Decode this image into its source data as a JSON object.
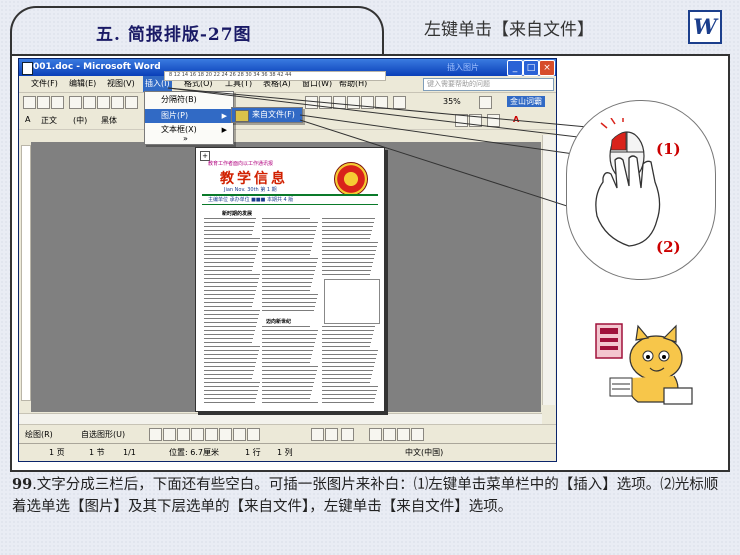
{
  "slide": {
    "section_title": "五. 简报排版-27图",
    "hint": "左键单击【来自文件】",
    "logo_letter": "W"
  },
  "window": {
    "title": "001.doc - Microsoft Word",
    "title_ghost": "插入图片",
    "help_placeholder": "键入需要帮助的问题"
  },
  "menubar": [
    "文件(F)",
    "编辑(E)",
    "视图(V)",
    "插入(I)",
    "格式(O)",
    "工具(T)",
    "表格(A)",
    "窗口(W)",
    "帮助(H)"
  ],
  "toolbar": {
    "zoom": "35%",
    "dict": "金山词霸",
    "style": "正文",
    "font_small": "(中)",
    "font": "黑体"
  },
  "insert_menu": {
    "items": [
      "分隔符(B)",
      "图片(P)",
      "文本框(X)"
    ],
    "more": "»"
  },
  "picture_submenu": {
    "items": [
      "来自文件(F)"
    ]
  },
  "ruler_numbers": "8 12 14 16 18 20 22 24 26 28 30   34 36 38   42 44",
  "page": {
    "header_small": "教育工作者面向以工作通讯报",
    "banner": "教学信息",
    "date": "Jian Nov. 30th 第 1 期",
    "subheader": "主编单位    承办单位   ■■■ 本期共 4 版",
    "col_heading1": "新时期的发展",
    "col_heading2": "迈向新世纪"
  },
  "drawbar": {
    "draw": "绘图(R)",
    "autoshapes": "自选图形(U)"
  },
  "statusbar": [
    "1 页",
    "1 节",
    "1/1",
    "位置: 6.7厘米",
    "1 行",
    "1 列",
    "中文(中国)"
  ],
  "callouts": {
    "label1": "(1)",
    "label2": "(2)"
  },
  "caption": {
    "number": "99",
    "text": ".文字分成三栏后，下面还有些空白。可插一张图片来补白：⑴左键单击菜单栏中的【插入】选项。⑵光标顺着选单选【图片】及其下层选单的【来自文件】，左键单击【来自文件】选项。"
  },
  "colors": {
    "accent": "#316ac5",
    "label_red": "#cc0000",
    "title_blue": "#1a1a66"
  }
}
